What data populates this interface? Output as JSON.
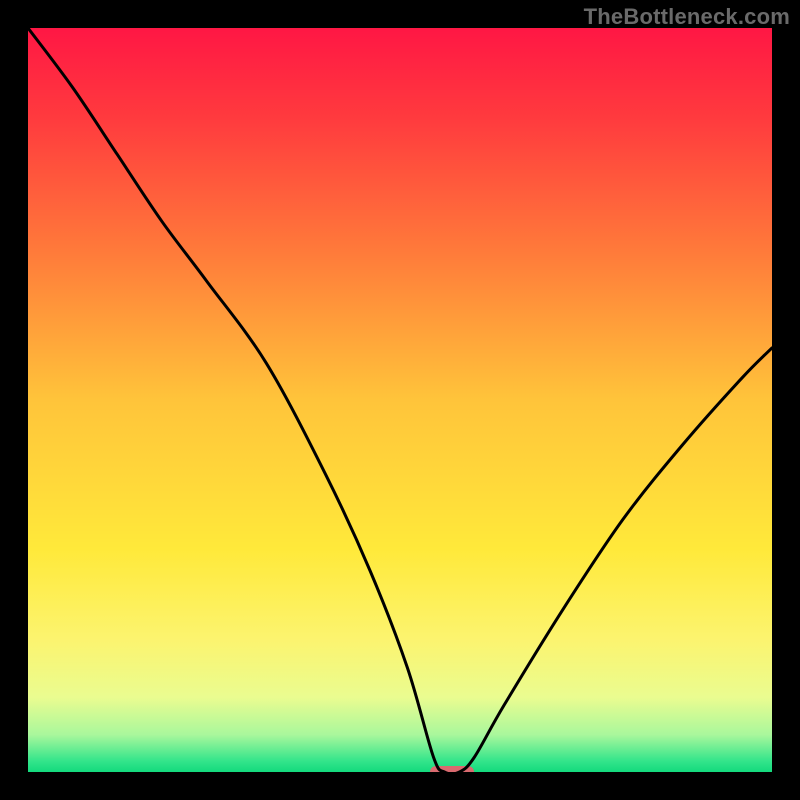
{
  "watermark": "TheBottleneck.com",
  "colors": {
    "frame": "#000000",
    "gradient_stops": [
      {
        "pos": 0.0,
        "color": "#ff1744"
      },
      {
        "pos": 0.12,
        "color": "#ff3a3e"
      },
      {
        "pos": 0.3,
        "color": "#ff7a3a"
      },
      {
        "pos": 0.5,
        "color": "#ffc43a"
      },
      {
        "pos": 0.7,
        "color": "#ffe93a"
      },
      {
        "pos": 0.82,
        "color": "#fcf46e"
      },
      {
        "pos": 0.9,
        "color": "#eafc90"
      },
      {
        "pos": 0.95,
        "color": "#a9f79c"
      },
      {
        "pos": 0.985,
        "color": "#34e58b"
      },
      {
        "pos": 1.0,
        "color": "#13da7d"
      }
    ],
    "curve": "#000000",
    "marker": "#d96a6f"
  },
  "chart_data": {
    "type": "line",
    "title": "",
    "xlabel": "",
    "ylabel": "",
    "xlim": [
      0,
      100
    ],
    "ylim": [
      0,
      100
    ],
    "series": [
      {
        "name": "bottleneck-curve",
        "x": [
          0,
          6,
          12,
          18,
          24,
          32,
          40,
          46,
          51,
          54.5,
          56,
          58,
          60,
          64,
          72,
          80,
          88,
          96,
          100
        ],
        "y": [
          100,
          92,
          83,
          74,
          66,
          55,
          40,
          27,
          14,
          2,
          0,
          0,
          2,
          9,
          22,
          34,
          44,
          53,
          57
        ]
      }
    ],
    "marker": {
      "x_center": 57,
      "y": 0,
      "width_pct": 6,
      "height_pct": 1.6
    },
    "legend": false,
    "grid": false
  }
}
